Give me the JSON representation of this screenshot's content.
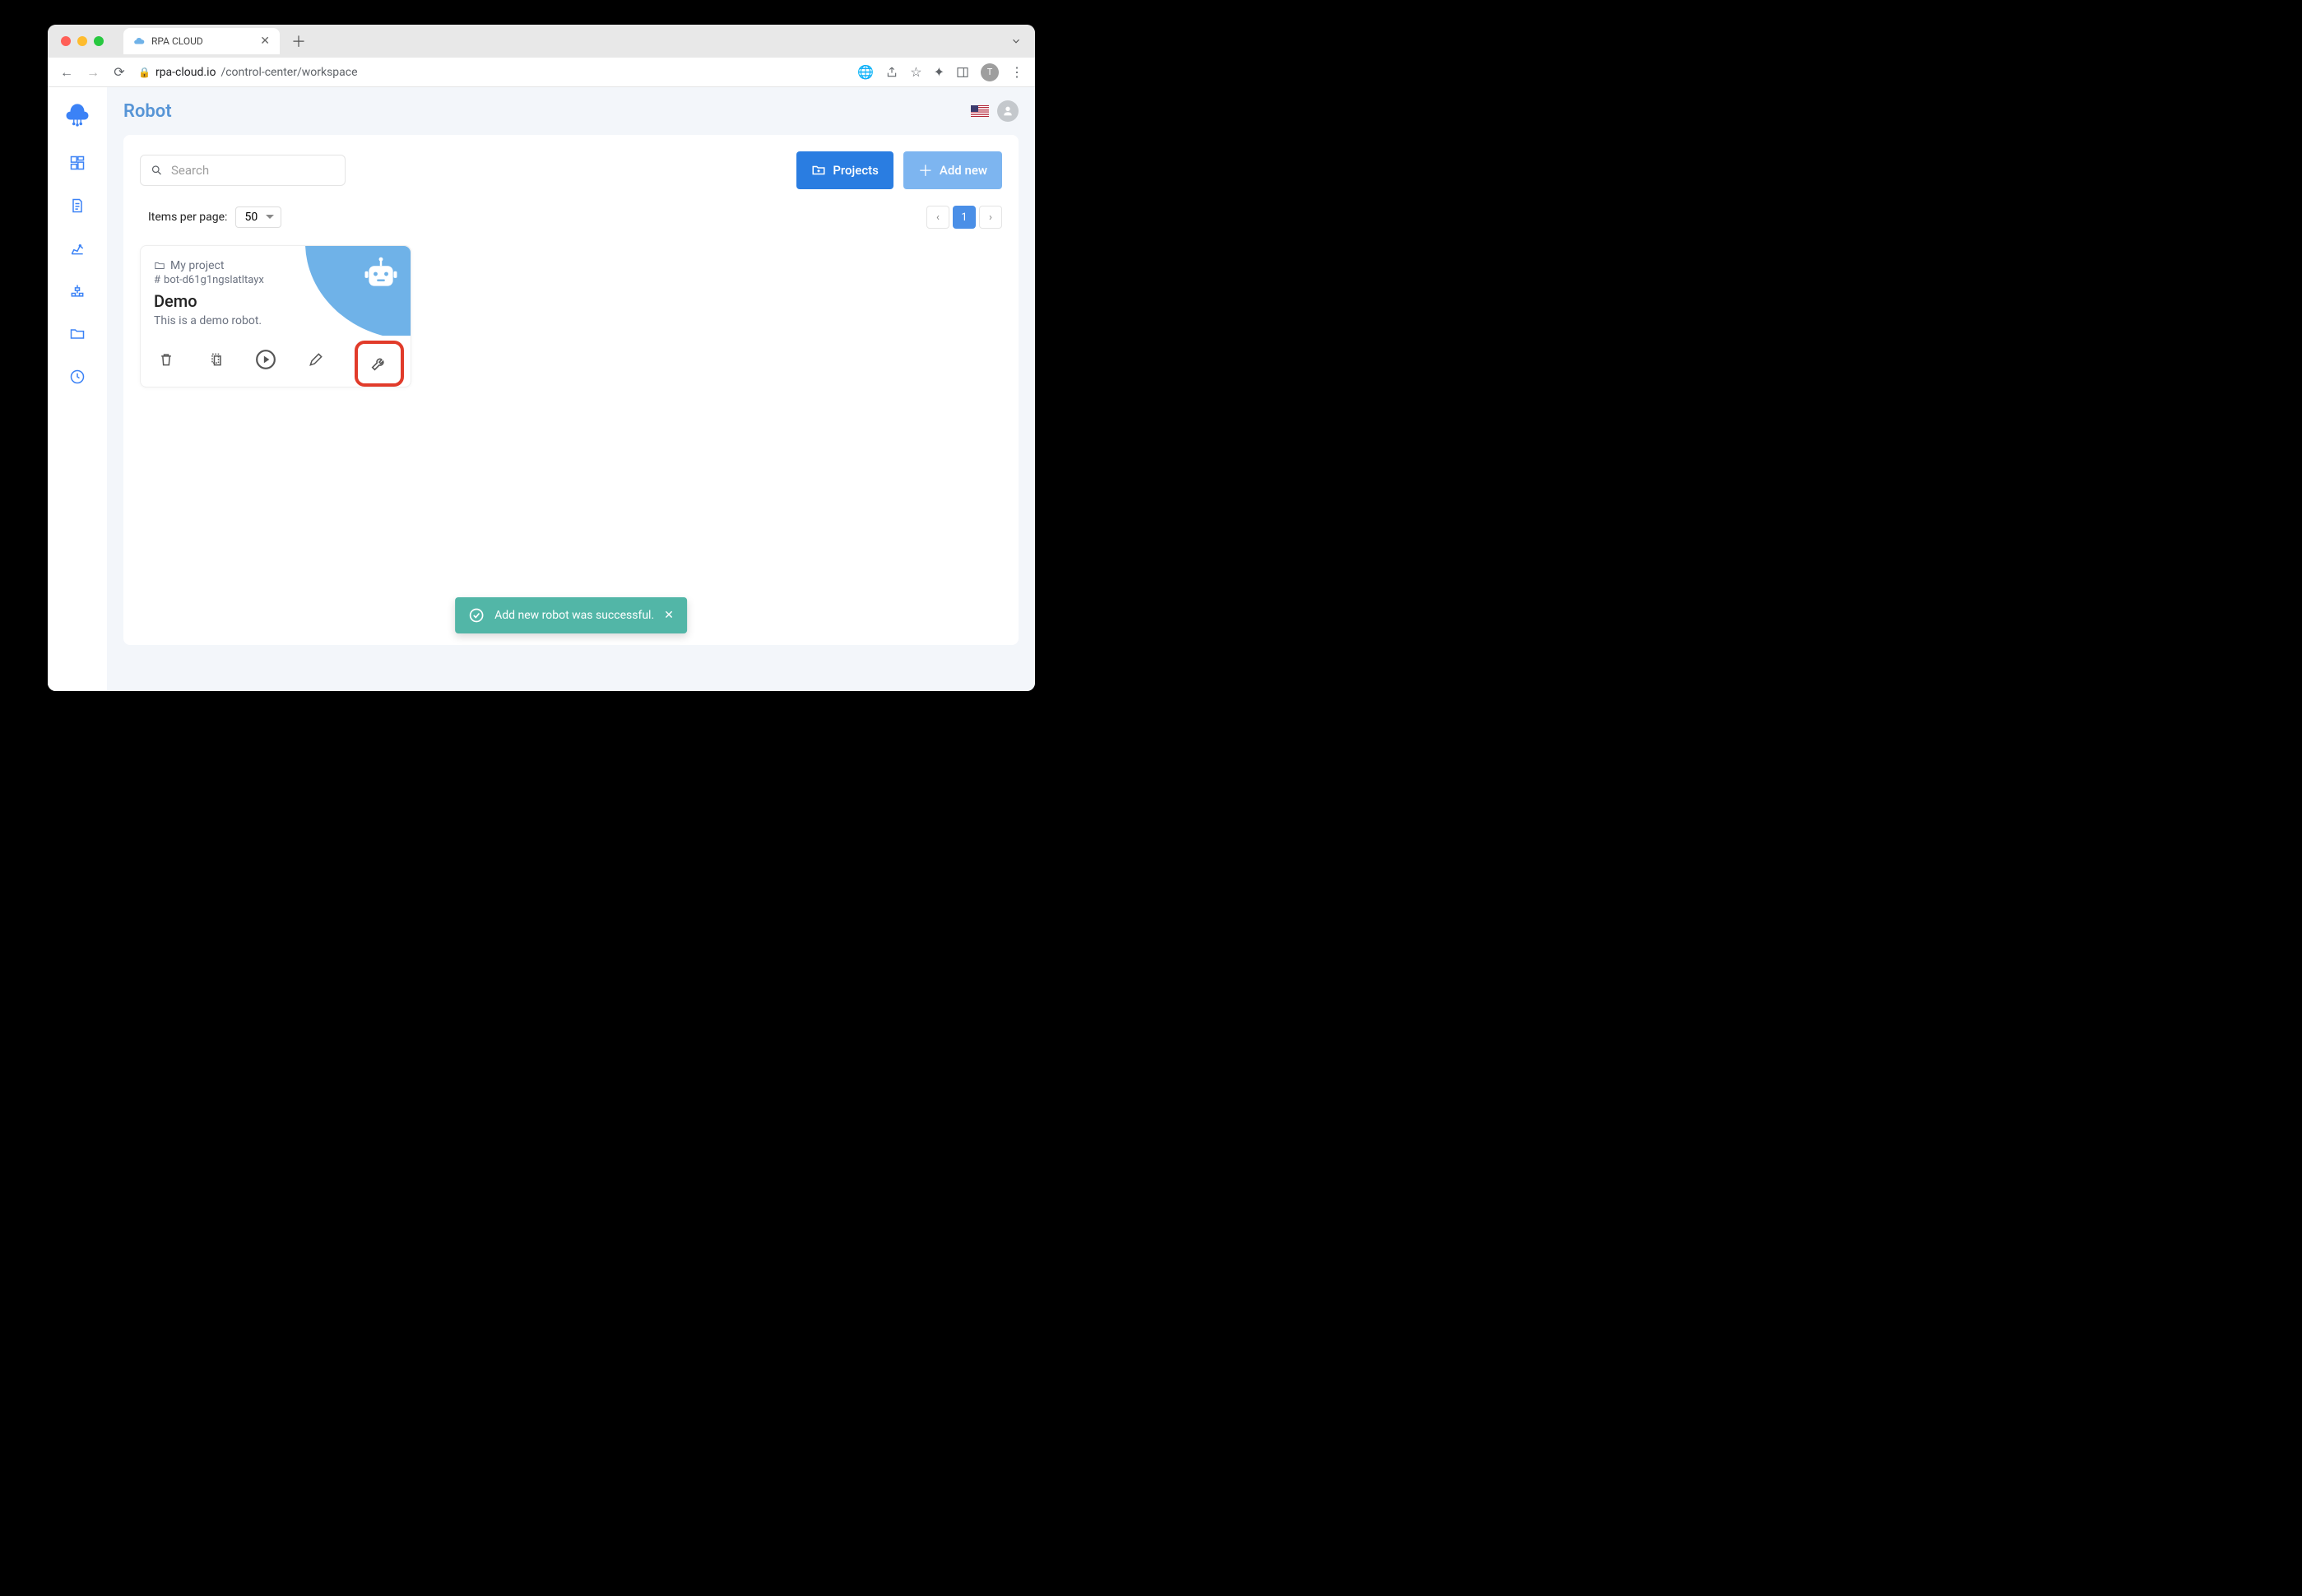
{
  "browser": {
    "tab_title": "RPA CLOUD",
    "url_domain": "rpa-cloud.io",
    "url_path": "/control-center/workspace",
    "avatar_letter": "T"
  },
  "page": {
    "title": "Robot"
  },
  "search": {
    "placeholder": "Search"
  },
  "buttons": {
    "projects": "Projects",
    "add_new": "Add new"
  },
  "listctrl": {
    "ipp_label": "Items per page:",
    "ipp_value": "50",
    "current_page": "1"
  },
  "card": {
    "project": "My project",
    "bot_id": "bot-d61g1ngslatltayx",
    "title": "Demo",
    "description": "This is a demo robot."
  },
  "toast": {
    "message": "Add new robot was successful."
  }
}
